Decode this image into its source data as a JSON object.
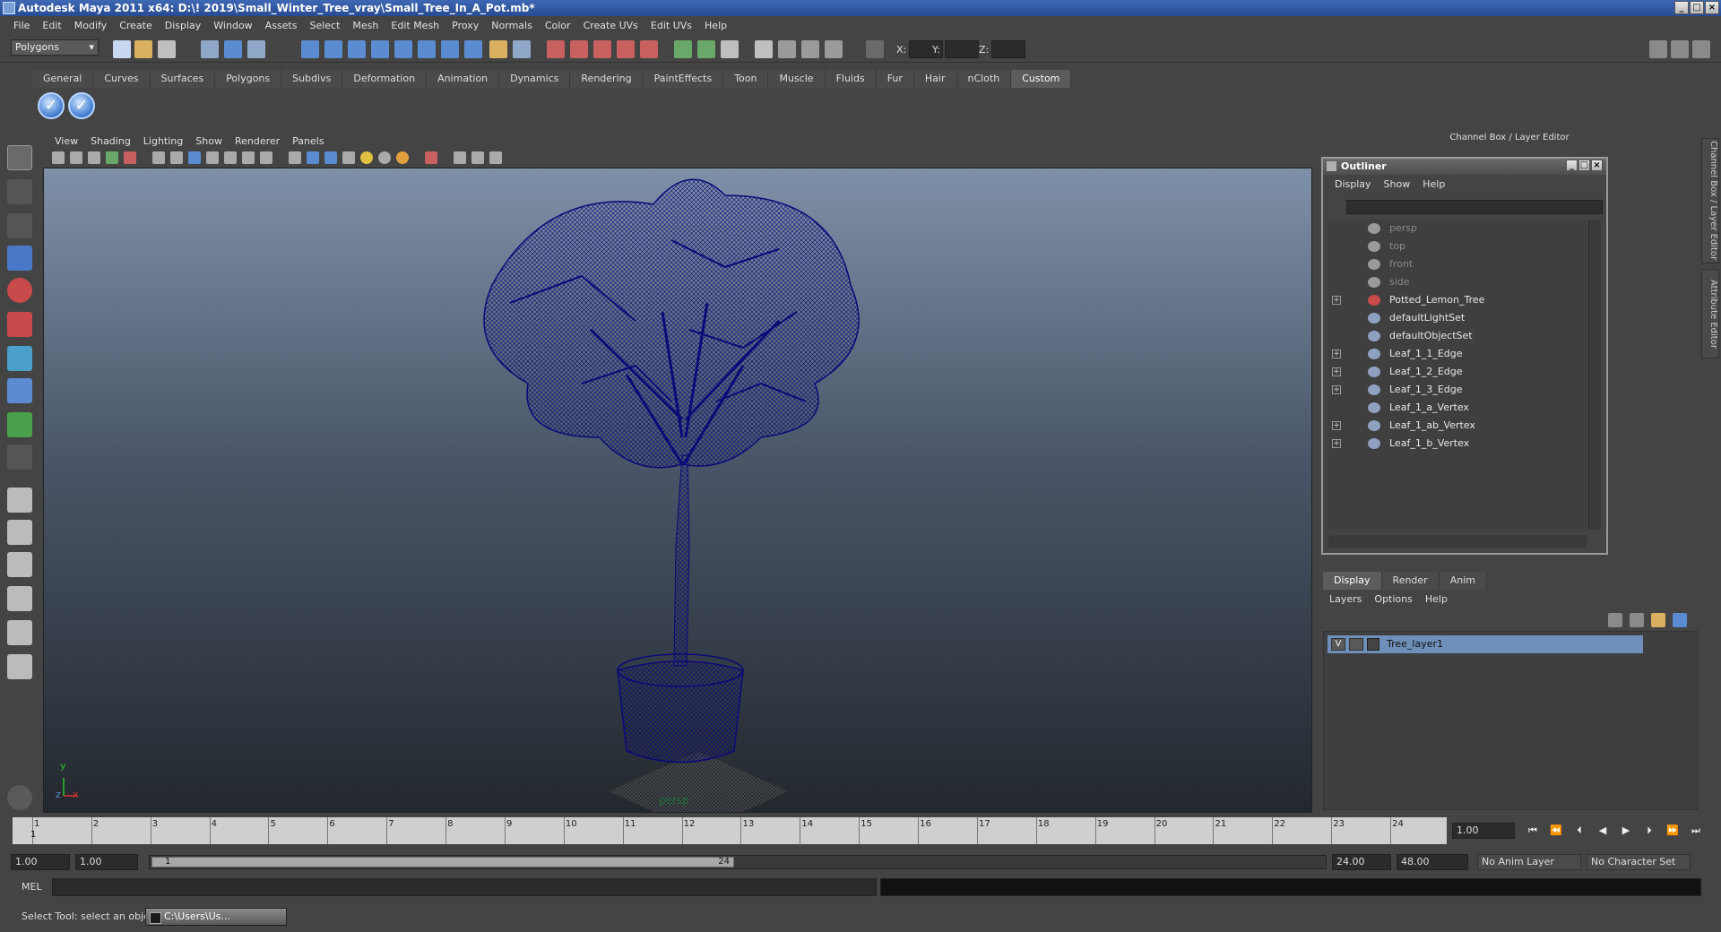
{
  "window": {
    "title": "Autodesk Maya 2011 x64: D:\\! 2019\\Small_Winter_Tree_vray\\Small_Tree_In_A_Pot.mb*",
    "minimize": "_",
    "maximize": "□",
    "close": "×"
  },
  "menubar": [
    "File",
    "Edit",
    "Modify",
    "Create",
    "Display",
    "Window",
    "Assets",
    "Select",
    "Mesh",
    "Edit Mesh",
    "Proxy",
    "Normals",
    "Color",
    "Create UVs",
    "Edit UVs",
    "Help"
  ],
  "statusline": {
    "mode": "Polygons",
    "x_label": "X:",
    "y_label": "Y:",
    "z_label": "Z:"
  },
  "shelf": {
    "tabs": [
      "General",
      "Curves",
      "Surfaces",
      "Polygons",
      "Subdivs",
      "Deformation",
      "Animation",
      "Dynamics",
      "Rendering",
      "PaintEffects",
      "Toon",
      "Muscle",
      "Fluids",
      "Fur",
      "Hair",
      "nCloth",
      "Custom"
    ],
    "active_tab": "Custom"
  },
  "viewport": {
    "menu": [
      "View",
      "Shading",
      "Lighting",
      "Show",
      "Renderer",
      "Panels"
    ],
    "camera_label": "persp",
    "axis_y": "y",
    "axis_z": "z",
    "axis_x": "x",
    "wire_color": "#0a0a78"
  },
  "right_panel": {
    "header": "Channel Box / Layer Editor",
    "side_tab_1": "Channel Box / Layer Editor",
    "side_tab_2": "Attribute Editor"
  },
  "outliner": {
    "title": "Outliner",
    "menu": [
      "Display",
      "Show",
      "Help"
    ],
    "items": [
      {
        "label": "persp",
        "dim": true,
        "expandable": false,
        "icon": "camera-icon"
      },
      {
        "label": "top",
        "dim": true,
        "expandable": false,
        "icon": "camera-icon"
      },
      {
        "label": "front",
        "dim": true,
        "expandable": false,
        "icon": "camera-icon"
      },
      {
        "label": "side",
        "dim": true,
        "expandable": false,
        "icon": "camera-icon"
      },
      {
        "label": "Potted_Lemon_Tree",
        "dim": false,
        "expandable": true,
        "icon": "transform-icon"
      },
      {
        "label": "defaultLightSet",
        "dim": false,
        "expandable": false,
        "icon": "set-icon"
      },
      {
        "label": "defaultObjectSet",
        "dim": false,
        "expandable": false,
        "icon": "set-icon"
      },
      {
        "label": "Leaf_1_1_Edge",
        "dim": false,
        "expandable": true,
        "icon": "set-icon"
      },
      {
        "label": "Leaf_1_2_Edge",
        "dim": false,
        "expandable": true,
        "icon": "set-icon"
      },
      {
        "label": "Leaf_1_3_Edge",
        "dim": false,
        "expandable": true,
        "icon": "set-icon"
      },
      {
        "label": "Leaf_1_a_Vertex",
        "dim": false,
        "expandable": false,
        "icon": "set-icon"
      },
      {
        "label": "Leaf_1_ab_Vertex",
        "dim": false,
        "expandable": true,
        "icon": "set-icon"
      },
      {
        "label": "Leaf_1_b_Vertex",
        "dim": false,
        "expandable": true,
        "icon": "set-icon"
      }
    ],
    "expand_glyph": "+"
  },
  "layer_editor": {
    "tabs": [
      "Display",
      "Render",
      "Anim"
    ],
    "active_tab": "Display",
    "menu": [
      "Layers",
      "Options",
      "Help"
    ],
    "layer": {
      "visible": "V",
      "name": "Tree_layer1"
    }
  },
  "timeslider": {
    "ticks": [
      "1",
      "2",
      "3",
      "4",
      "5",
      "6",
      "7",
      "8",
      "9",
      "10",
      "11",
      "12",
      "13",
      "14",
      "15",
      "16",
      "17",
      "18",
      "19",
      "20",
      "21",
      "22",
      "23",
      "24"
    ],
    "current_frame_marker": "1",
    "current_frame": "1.00"
  },
  "playback": [
    "⏮",
    "⏪",
    "⏴",
    "◀",
    "▶",
    "⏵",
    "⏩",
    "⏭"
  ],
  "range": {
    "start": "1.00",
    "playback_start": "1.00",
    "handle_start": "1",
    "handle_end": "24",
    "playback_end": "24.00",
    "end": "48.00",
    "anim_layer": "No Anim Layer",
    "character_set": "No Character Set"
  },
  "commandline": {
    "label": "MEL"
  },
  "helpline": {
    "text": "Select Tool: select an object",
    "taskbar_item": "C:\\Users\\Us..."
  }
}
